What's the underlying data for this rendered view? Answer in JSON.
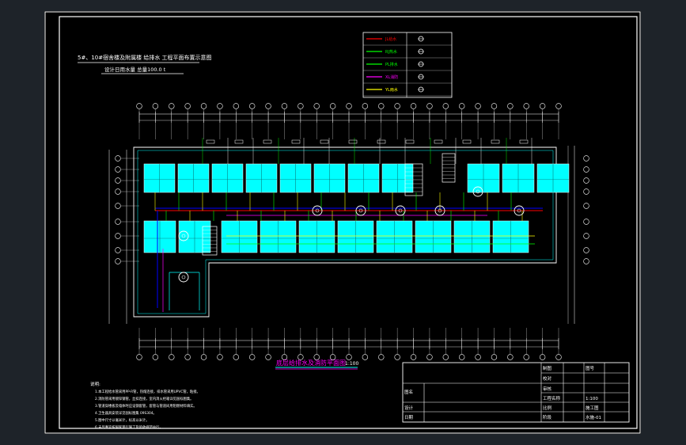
{
  "drawing": {
    "title": "5#、10#宿舍楼及附属楼 给排水 工程平面布置示意图",
    "subtitle": "设计日用水量 总量100.0 t",
    "plan_caption": "底层给排水及消防平面图",
    "plan_scale": "1:100",
    "colors": {
      "background": "#000000",
      "frame": "#ffffff",
      "room_fill": "#00ffff",
      "cold_water": "#ff0000",
      "hot_water": "#00ff00",
      "drain": "#ffff00",
      "fire": "#ff00ff",
      "wall": "#00ffff",
      "pipe_blue": "#0000ff"
    }
  },
  "legend": {
    "rows": [
      {
        "line_label": "JL给水",
        "color": "#ff0000",
        "symbol_icon": "valve-icon"
      },
      {
        "line_label": "RJ热水",
        "color": "#00ff00",
        "symbol_icon": "meter-icon"
      },
      {
        "line_label": "PL排水",
        "color": "#00ff00",
        "symbol_icon": "cleanout-icon"
      },
      {
        "line_label": "XL消防",
        "color": "#ff00ff",
        "symbol_icon": "hydrant-icon"
      },
      {
        "line_label": "YL雨水",
        "color": "#ffff00",
        "symbol_icon": "drain-icon"
      }
    ]
  },
  "notes": {
    "heading": "说明:",
    "lines": [
      "1.本工程给水管采用PP-R管，热熔连接，排水管采用UPVC管，粘接。",
      "2.消防管采用镀锌钢管，丝扣连接，室内消火栓箱详见国标图集。",
      "3.管道穿楼板及墙体时应设钢套管，套管与管道间用阻燃材料填实。",
      "4.卫生器具安装详见国标图集 09S304。",
      "5.图中尺寸以毫米计，标高以米计。",
      "6.未尽事宜按国家现行施工及验收规范执行。"
    ]
  },
  "title_block": {
    "project_label": "工程名称",
    "drawing_label": "图名",
    "drawn_label": "制图",
    "checked_label": "校对",
    "approved_label": "审核",
    "design_label": "设计",
    "date_label": "日期",
    "sheet_label": "图号",
    "scale_label": "比例",
    "scale_value": "1:100",
    "stage_label": "阶段",
    "stage_value": "施工图",
    "no_value": "水施-01"
  }
}
